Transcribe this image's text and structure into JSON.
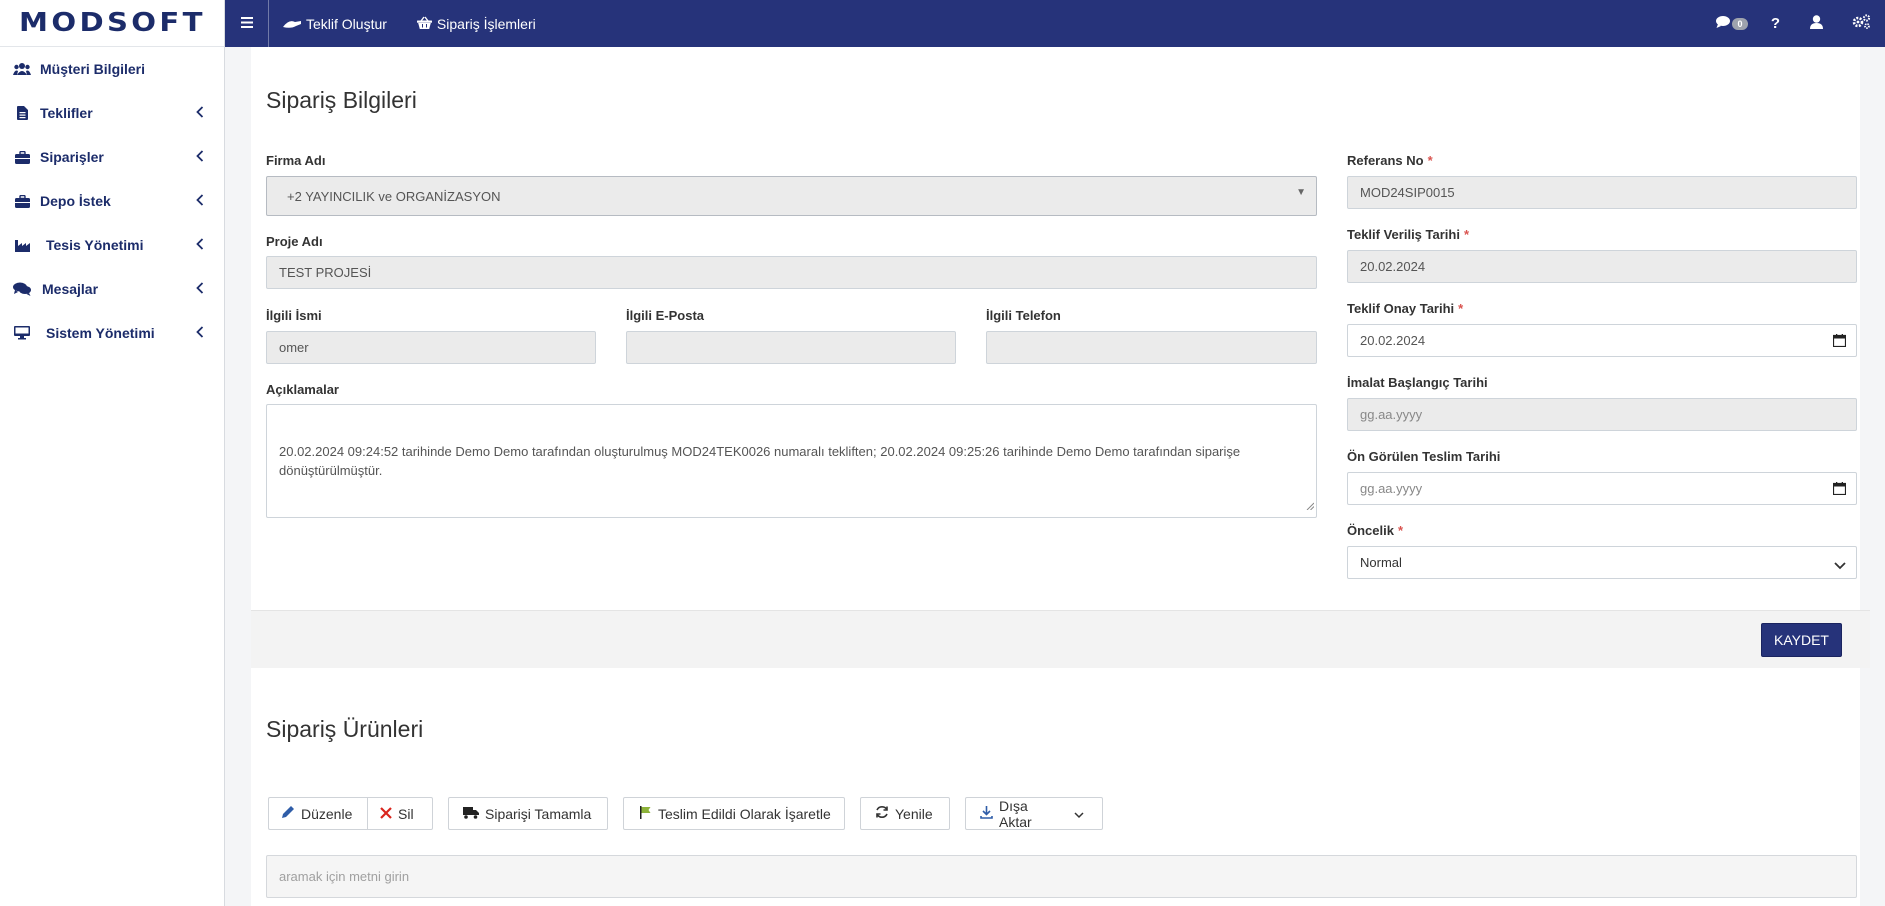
{
  "brand": {
    "logo_text": "MODSOFT"
  },
  "sidebar": {
    "items": [
      {
        "label": "Müşteri Bilgileri",
        "icon": "users-icon",
        "has_chevron": false
      },
      {
        "label": "Teklifler",
        "icon": "file-icon",
        "has_chevron": true
      },
      {
        "label": "Siparişler",
        "icon": "briefcase-icon",
        "has_chevron": true
      },
      {
        "label": "Depo İstek",
        "icon": "briefcase-icon",
        "has_chevron": true
      },
      {
        "label": "Tesis Yönetimi",
        "icon": "industry-icon",
        "has_chevron": true
      },
      {
        "label": "Mesajlar",
        "icon": "comments-icon",
        "has_chevron": true
      },
      {
        "label": "Sistem Yönetimi",
        "icon": "desktop-icon",
        "has_chevron": true
      }
    ]
  },
  "topbar": {
    "links": [
      {
        "label": "Teklif Oluştur",
        "icon": "handshake-icon"
      },
      {
        "label": "Sipariş İşlemleri",
        "icon": "basket-icon"
      }
    ],
    "message_count": "0",
    "help_label": "?"
  },
  "form": {
    "title": "Sipariş Bilgileri",
    "firma_label": "Firma Adı",
    "firma_value": "+2 YAYINCILIK ve ORGANİZASYON",
    "proje_label": "Proje Adı",
    "proje_value": "TEST PROJESİ",
    "ilgili_isim_label": "İlgili İsmi",
    "ilgili_isim_value": "omer",
    "ilgili_eposta_label": "İlgili E-Posta",
    "ilgili_eposta_value": "",
    "ilgili_telefon_label": "İlgili Telefon",
    "ilgili_telefon_value": "",
    "aciklama_label": "Açıklamalar",
    "aciklama_value": "20.02.2024 09:24:52 tarihinde Demo Demo tarafından oluşturulmuş MOD24TEK0026 numaralı tekliften; 20.02.2024 09:25:26 tarihinde Demo Demo tarafından siparişe dönüştürülmüştür.",
    "referans_label": "Referans No",
    "referans_value": "MOD24SIP0015",
    "teklif_verilis_label": "Teklif Veriliş Tarihi",
    "teklif_verilis_value": "20.02.2024",
    "teklif_onay_label": "Teklif Onay Tarihi",
    "teklif_onay_value": "20.02.2024",
    "imalat_label": "İmalat Başlangıç Tarihi",
    "imalat_value": "gg.aa.yyyy",
    "teslim_label": "Ön Görülen Teslim Tarihi",
    "teslim_value": "gg.aa.yyyy",
    "oncelik_label": "Öncelik",
    "oncelik_value": "Normal",
    "required_mark": "*",
    "save_label": "KAYDET"
  },
  "products": {
    "title": "Sipariş Ürünleri",
    "buttons": {
      "edit": "Düzenle",
      "delete": "Sil",
      "complete": "Siparişi Tamamla",
      "delivered": "Teslim Edildi Olarak İşaretle",
      "refresh": "Yenile",
      "export": "Dışa Aktar"
    },
    "search_placeholder": "aramak için metni girin"
  },
  "colors": {
    "primary": "#26337a",
    "brand_text": "#1c2c6a",
    "required": "#d9534f",
    "delete_x": "#d9251d"
  }
}
